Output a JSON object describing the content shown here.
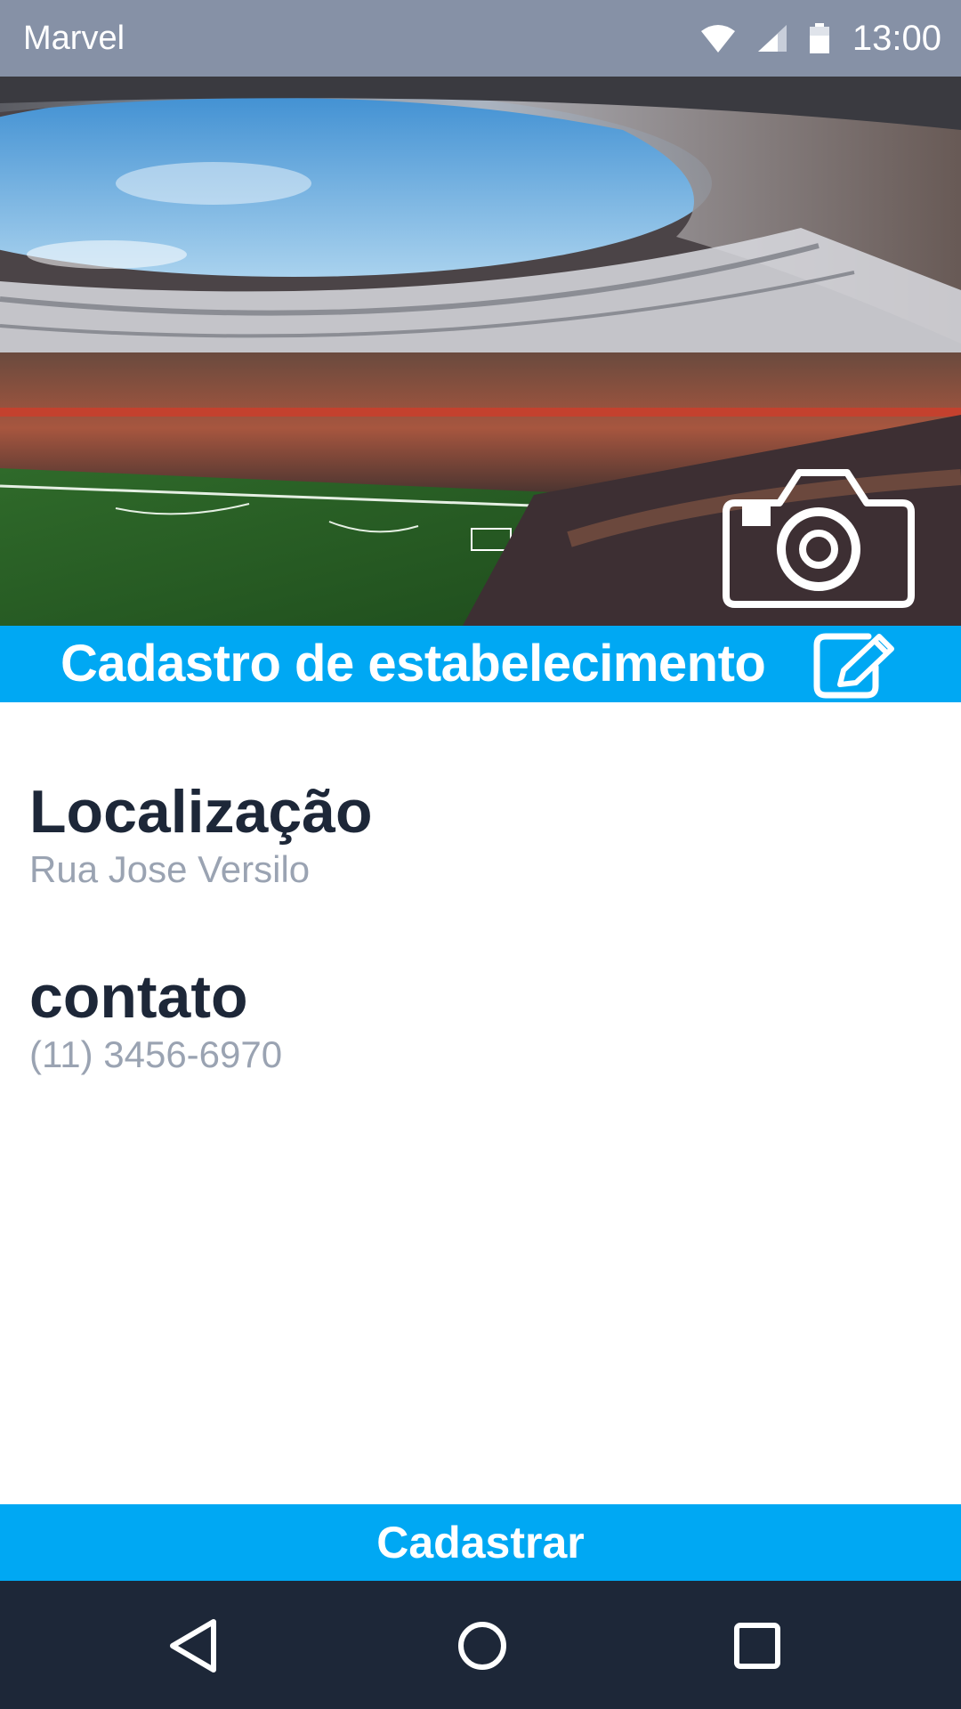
{
  "status_bar": {
    "app_name": "Marvel",
    "time": "13:00",
    "icons": [
      "wifi-icon",
      "cell-signal-icon",
      "battery-icon"
    ]
  },
  "hero": {
    "image": "stadium-photo",
    "camera_icon": "camera-icon"
  },
  "banner": {
    "title": "Cadastro de estabelecimento",
    "edit_icon": "pencil-edit-icon"
  },
  "location": {
    "heading": "Localização",
    "value": "Rua Jose Versilo"
  },
  "contact": {
    "heading": "contato",
    "value": "(11) 3456-6970"
  },
  "actions": {
    "register_label": "Cadastrar"
  },
  "nav_bar": {
    "icons": [
      "back-icon",
      "home-icon",
      "recent-apps-icon"
    ]
  },
  "colors": {
    "status_bar": "#8691a6",
    "accent": "#00a8f3",
    "heading_text": "#1d2738",
    "muted_text": "#9aa3b2",
    "nav_bar": "#1d2738"
  }
}
